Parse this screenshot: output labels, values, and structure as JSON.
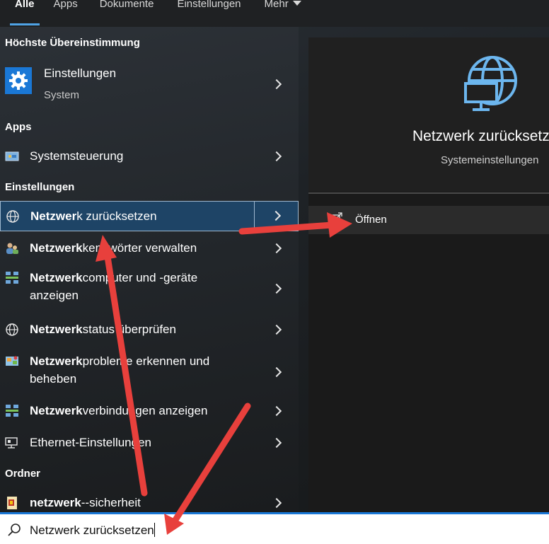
{
  "tabs": [
    {
      "label": "Alle",
      "active": true
    },
    {
      "label": "Apps"
    },
    {
      "label": "Dokumente"
    },
    {
      "label": "Einstellungen"
    },
    {
      "label": "Mehr"
    }
  ],
  "sections": {
    "best": "Höchste Übereinstimmung",
    "apps": "Apps",
    "settings": "Einstellungen",
    "folders": "Ordner"
  },
  "best_match": {
    "title": "Einstellungen",
    "subtitle": "System",
    "icon": "gear-icon"
  },
  "results": [
    {
      "bold": "",
      "rest": "Systemsteuerung",
      "icon": "control-panel-icon"
    },
    {
      "bold": "Netzwer",
      "rest": "k zurücksetzen",
      "icon": "globe-icon",
      "selected": true
    },
    {
      "bold": "Netzwerk",
      "rest": "kennwörter verwalten",
      "icon": "users-key-icon"
    },
    {
      "bold": "Netzwerk",
      "rest": "computer und -geräte",
      "line2": "anzeigen",
      "icon": "network-grid-icon"
    },
    {
      "bold": "Netzwerk",
      "rest": "status überprüfen",
      "icon": "globe-icon"
    },
    {
      "bold": "Netzwerk",
      "rest": "probleme erkennen und",
      "line2": "beheben",
      "icon": "network-troubleshoot-icon"
    },
    {
      "bold": "Netzwerk",
      "rest": "verbindungen anzeigen",
      "icon": "network-grid-icon"
    },
    {
      "bold": "",
      "rest": "Ethernet-Einstellungen",
      "icon": "monitor-network-icon"
    },
    {
      "bold": "netzwerk",
      "rest": "--sicherheit",
      "icon": "folder-icon"
    }
  ],
  "preview": {
    "title": "Netzwerk zurücksetzen",
    "subtitle": "Systemeinstellungen",
    "icon": "globe-monitor-icon",
    "action_label": "Öffnen",
    "action_icon": "open-external-icon"
  },
  "search": {
    "value": "Netzwerk zurücksetzen",
    "icon": "search-icon"
  },
  "colors": {
    "accent": "#1a78d6",
    "selected_bg": "#1e4466",
    "annotation": "#e8403c"
  }
}
